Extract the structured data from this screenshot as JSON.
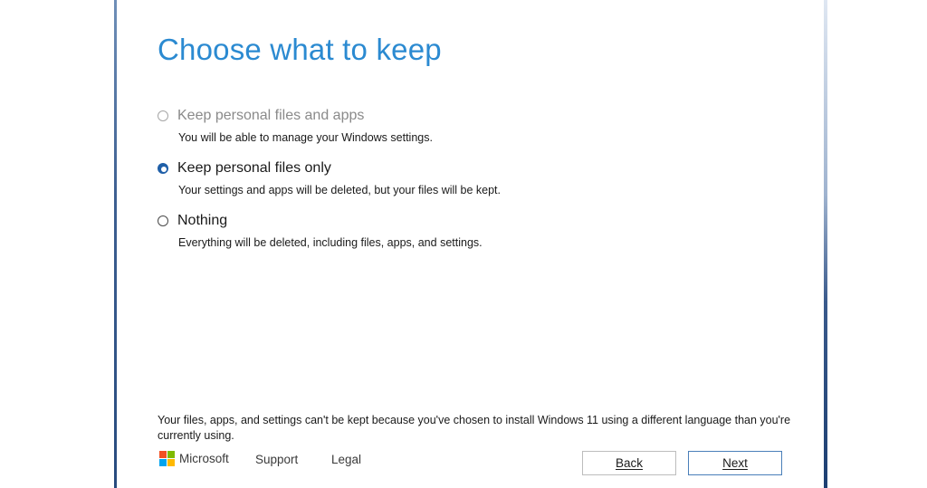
{
  "title": "Choose what to keep",
  "options": [
    {
      "label": "Keep personal files and apps",
      "description": "You will be able to manage your Windows settings.",
      "state": "disabled"
    },
    {
      "label": "Keep personal files only",
      "description": "Your settings and apps will be deleted, but your files will be kept.",
      "state": "selected"
    },
    {
      "label": "Nothing",
      "description": "Everything will be deleted, including files, apps, and settings.",
      "state": "unselected"
    }
  ],
  "notice": "Your files, apps, and settings can't be kept because you've chosen to install  Windows 11 using a different language than you're currently using.",
  "footer": {
    "brand": "Microsoft",
    "support": "Support",
    "legal": "Legal",
    "logo_colors": [
      "#f25022",
      "#7fba00",
      "#00a4ef",
      "#ffb900"
    ]
  },
  "buttons": {
    "back": "Back",
    "next": "Next"
  },
  "colors": {
    "title": "#2b8ad1",
    "selected_radio": "#1f5fa8",
    "next_border": "#4a7fb9"
  }
}
